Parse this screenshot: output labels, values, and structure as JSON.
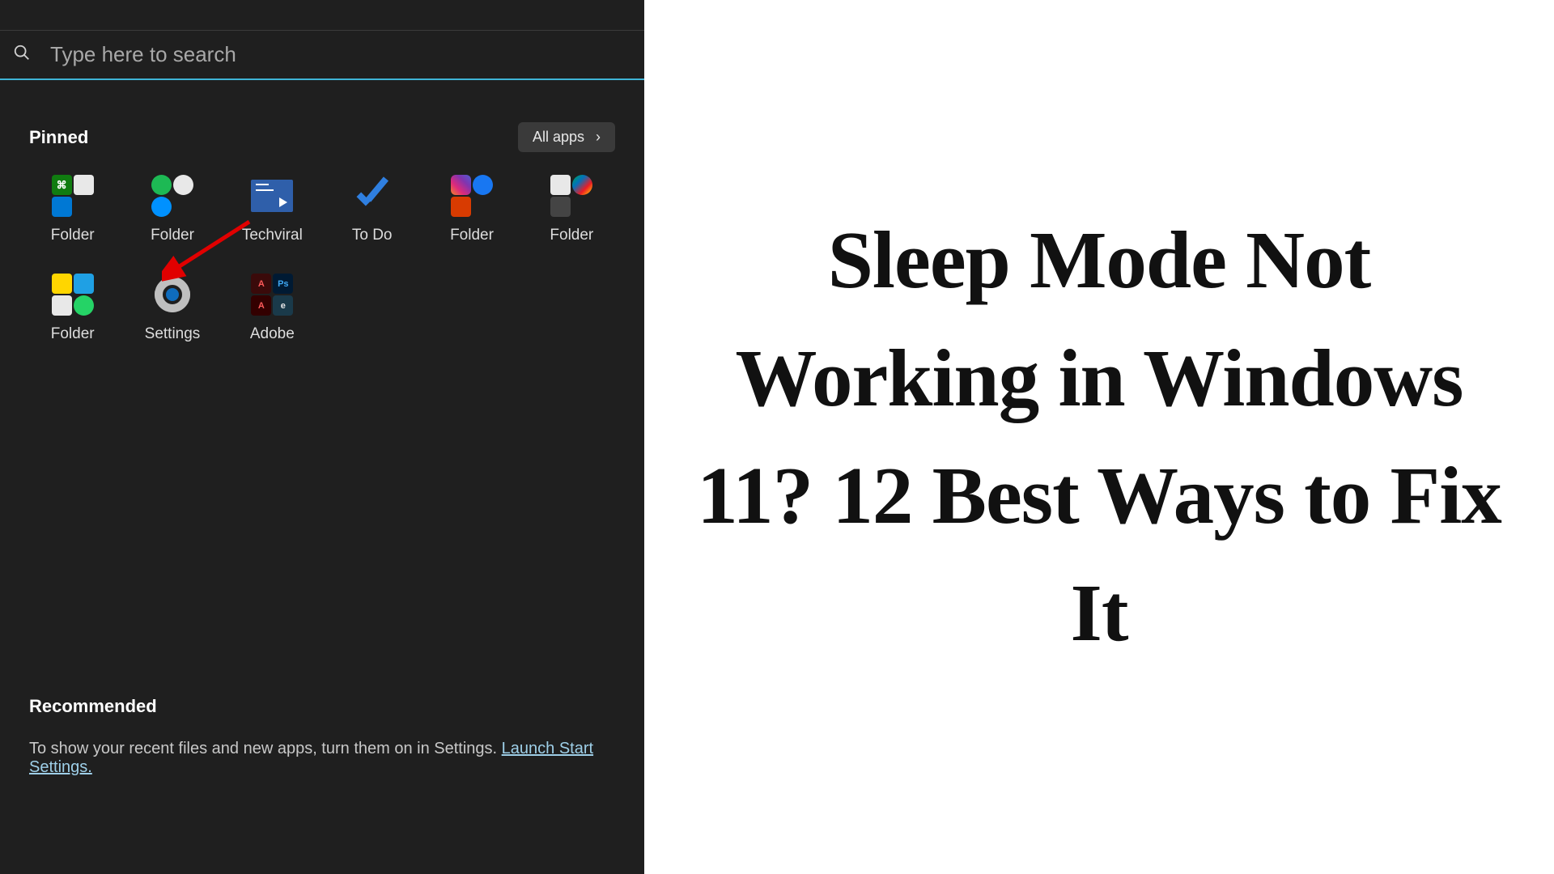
{
  "search": {
    "placeholder": "Type here to search",
    "value": ""
  },
  "pinned": {
    "title": "Pinned",
    "all_apps_label": "All apps",
    "tiles": [
      {
        "label": "Folder"
      },
      {
        "label": "Folder"
      },
      {
        "label": "Techviral"
      },
      {
        "label": "To Do"
      },
      {
        "label": "Folder"
      },
      {
        "label": "Folder"
      },
      {
        "label": "Folder"
      },
      {
        "label": "Settings"
      },
      {
        "label": "Adobe"
      }
    ]
  },
  "recommended": {
    "title": "Recommended",
    "text_prefix": "To show your recent files and new apps, turn them on in Settings. ",
    "link_text": "Launch Start Settings."
  },
  "headline": "Sleep Mode Not Working in Windows 11? 12 Best Ways to Fix It",
  "annotation": {
    "arrow_color": "#e10000",
    "target": "Settings"
  }
}
